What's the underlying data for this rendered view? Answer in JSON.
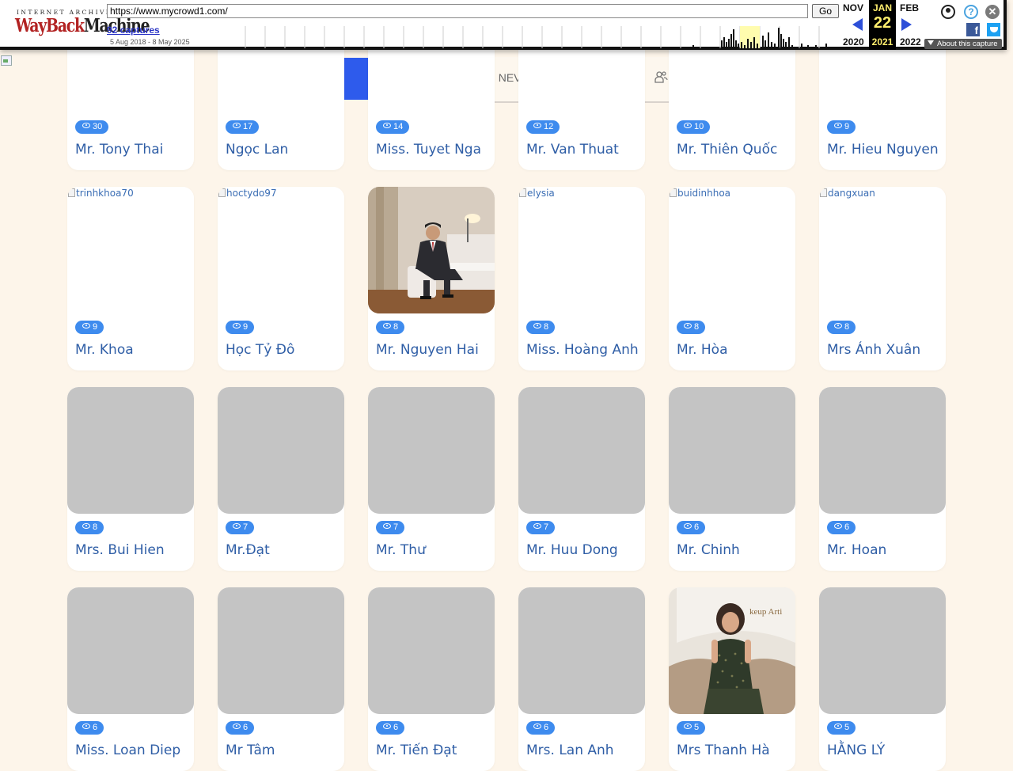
{
  "wayback": {
    "logo_top": "INTERNET ARCHIVE",
    "logo_wayback": "WayBack",
    "logo_machine": "Machine",
    "url": "https://www.mycrowd1.com/",
    "go_label": "Go",
    "captures": "92 captures",
    "date_range": "5 Aug 2018 - 8 May 2025",
    "prev_month": "NOV",
    "prev_year": "2020",
    "cur_month": "JAN",
    "cur_day": "22",
    "cur_year": "2021",
    "next_month": "FEB",
    "next_year": "2022",
    "about": "About this capture",
    "help": "?",
    "close": "✕",
    "facebook": "f"
  },
  "nav": {
    "partial_text": "I NEV"
  },
  "cards": [
    {
      "name": "Mr. Tony Thai",
      "views": "30",
      "photo": "blank",
      "alt": ""
    },
    {
      "name": "Ngọc Lan",
      "views": "17",
      "photo": "blank",
      "alt": ""
    },
    {
      "name": "Miss. Tuyet Nga",
      "views": "14",
      "photo": "blank",
      "alt": ""
    },
    {
      "name": "Mr. Van Thuat",
      "views": "12",
      "photo": "blank",
      "alt": ""
    },
    {
      "name": "Mr. Thiên Quốc",
      "views": "10",
      "photo": "blank",
      "alt": ""
    },
    {
      "name": "Mr. Hieu Nguyen",
      "views": "9",
      "photo": "blank",
      "alt": ""
    },
    {
      "name": "Mr. Khoa",
      "views": "9",
      "photo": "broken",
      "alt": "trinhkhoa70"
    },
    {
      "name": "Học Tỷ Đô",
      "views": "9",
      "photo": "broken",
      "alt": "hoctydo97"
    },
    {
      "name": "Mr. Nguyen Hai",
      "views": "8",
      "photo": "man",
      "alt": ""
    },
    {
      "name": "Miss. Hoàng Anh",
      "views": "8",
      "photo": "broken",
      "alt": "elysia"
    },
    {
      "name": "Mr. Hòa",
      "views": "8",
      "photo": "broken",
      "alt": "buidinhhoa"
    },
    {
      "name": "Mrs Ánh Xuân",
      "views": "8",
      "photo": "broken",
      "alt": "dangxuan"
    },
    {
      "name": "Mrs. Bui Hien",
      "views": "8",
      "photo": "gray",
      "alt": ""
    },
    {
      "name": "Mr.Đạt",
      "views": "7",
      "photo": "gray",
      "alt": ""
    },
    {
      "name": "Mr. Thư",
      "views": "7",
      "photo": "gray",
      "alt": ""
    },
    {
      "name": "Mr. Huu Dong",
      "views": "7",
      "photo": "gray",
      "alt": ""
    },
    {
      "name": "Mr. Chinh",
      "views": "6",
      "photo": "gray",
      "alt": ""
    },
    {
      "name": "Mr. Hoan",
      "views": "6",
      "photo": "gray",
      "alt": ""
    },
    {
      "name": "Miss. Loan Diep",
      "views": "6",
      "photo": "gray",
      "alt": ""
    },
    {
      "name": "Mr Tâm",
      "views": "6",
      "photo": "gray",
      "alt": ""
    },
    {
      "name": "Mr. Tiến Đạt",
      "views": "6",
      "photo": "gray",
      "alt": ""
    },
    {
      "name": "Mrs. Lan Anh",
      "views": "6",
      "photo": "gray",
      "alt": ""
    },
    {
      "name": "Mrs Thanh Hà",
      "views": "5",
      "photo": "woman",
      "alt": "",
      "photo_text": "keup Arti"
    },
    {
      "name": "HẰNG LÝ",
      "views": "5",
      "photo": "gray",
      "alt": ""
    }
  ]
}
